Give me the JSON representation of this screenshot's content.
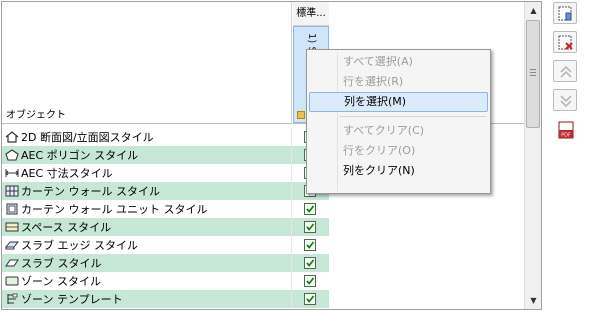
{
  "table": {
    "object_column_label": "オブジェクト",
    "column_header": "標準...",
    "column_subheader": "1) Sample P...",
    "rows": [
      {
        "label": "2D 断面図/立面図スタイル",
        "icon": "section-elevation-style-icon",
        "checked": true
      },
      {
        "label": "AEC ポリゴン スタイル",
        "icon": "polygon-style-icon",
        "checked": true
      },
      {
        "label": "AEC 寸法スタイル",
        "icon": "dimension-style-icon",
        "checked": true
      },
      {
        "label": "カーテン ウォール スタイル",
        "icon": "curtain-wall-style-icon",
        "checked": true
      },
      {
        "label": "カーテン ウォール ユニット スタイル",
        "icon": "curtain-wall-unit-style-icon",
        "checked": true
      },
      {
        "label": "スペース スタイル",
        "icon": "space-style-icon",
        "checked": true
      },
      {
        "label": "スラブ エッジ スタイル",
        "icon": "slab-edge-style-icon",
        "checked": true
      },
      {
        "label": "スラブ スタイル",
        "icon": "slab-style-icon",
        "checked": true
      },
      {
        "label": "ゾーン スタイル",
        "icon": "zone-style-icon",
        "checked": true
      },
      {
        "label": "ゾーン テンプレート",
        "icon": "zone-template-icon",
        "checked": true
      }
    ]
  },
  "context_menu": {
    "items": [
      {
        "label": "すべて選択(A)",
        "enabled": false
      },
      {
        "label": "行を選択(R)",
        "enabled": false
      },
      {
        "label": "列を選択(M)",
        "enabled": true,
        "highlighted": true
      },
      {
        "label": "すべてクリア(C)",
        "enabled": false
      },
      {
        "label": "行をクリア(O)",
        "enabled": false
      },
      {
        "label": "列をクリア(N)",
        "enabled": true
      }
    ]
  },
  "toolbar": {
    "buttons": [
      {
        "name": "add-drawing-icon",
        "enabled": true
      },
      {
        "name": "remove-drawing-icon",
        "enabled": true
      },
      {
        "name": "move-up-icon",
        "enabled": false
      },
      {
        "name": "move-down-icon",
        "enabled": false
      },
      {
        "name": "pdf-report-icon",
        "enabled": true
      }
    ]
  },
  "colors": {
    "alt_row": "#c6e6d6",
    "column_highlight": "#cfe6fa",
    "menu_highlight": "#dcebfc",
    "disabled_text": "#9c9c9c"
  }
}
